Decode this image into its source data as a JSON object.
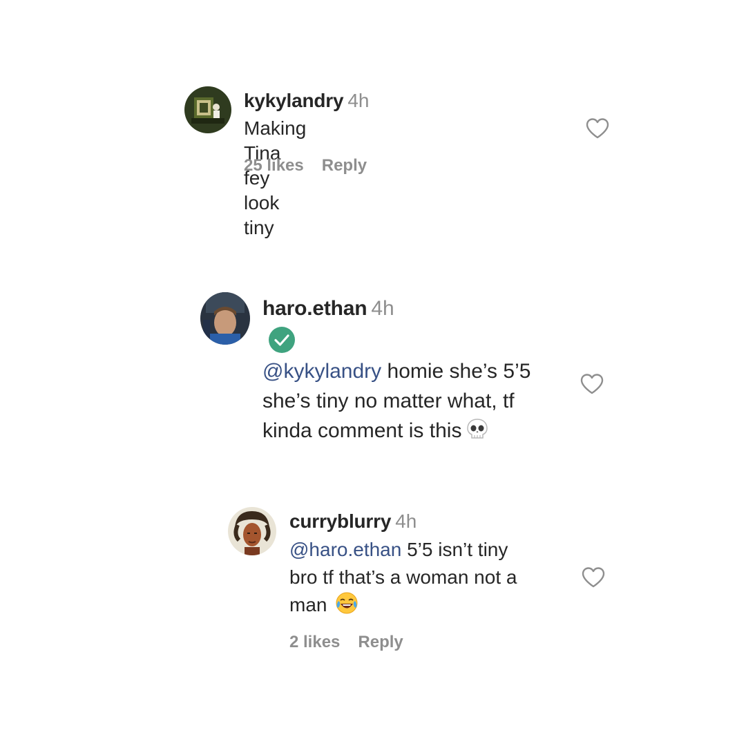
{
  "comments": [
    {
      "username": "kykylandry",
      "time": "4h",
      "text": "Making Tina fey look tiny",
      "likes": "25 likes",
      "reply": "Reply"
    },
    {
      "username": "haro.ethan",
      "time": "4h",
      "verified": true,
      "mention": "@kykylandry",
      "text_line1": " homie she’s 5’5",
      "text_line2": "she’s tiny no matter what, tf",
      "text_line3": "kinda comment is this",
      "emoji": "skull-emoji"
    },
    {
      "username": "curryblurry",
      "time": "4h",
      "mention": "@haro.ethan",
      "text_line1": " 5’5 isn’t tiny",
      "text_line2": "bro tf that’s a woman not a",
      "text_line3": "man",
      "emoji": "laughing-tears-emoji",
      "likes": "2 likes",
      "reply": "Reply"
    }
  ],
  "colors": {
    "text": "#262626",
    "muted": "#8e8e8e",
    "mention": "#385185",
    "verified": "#3fa37f"
  }
}
